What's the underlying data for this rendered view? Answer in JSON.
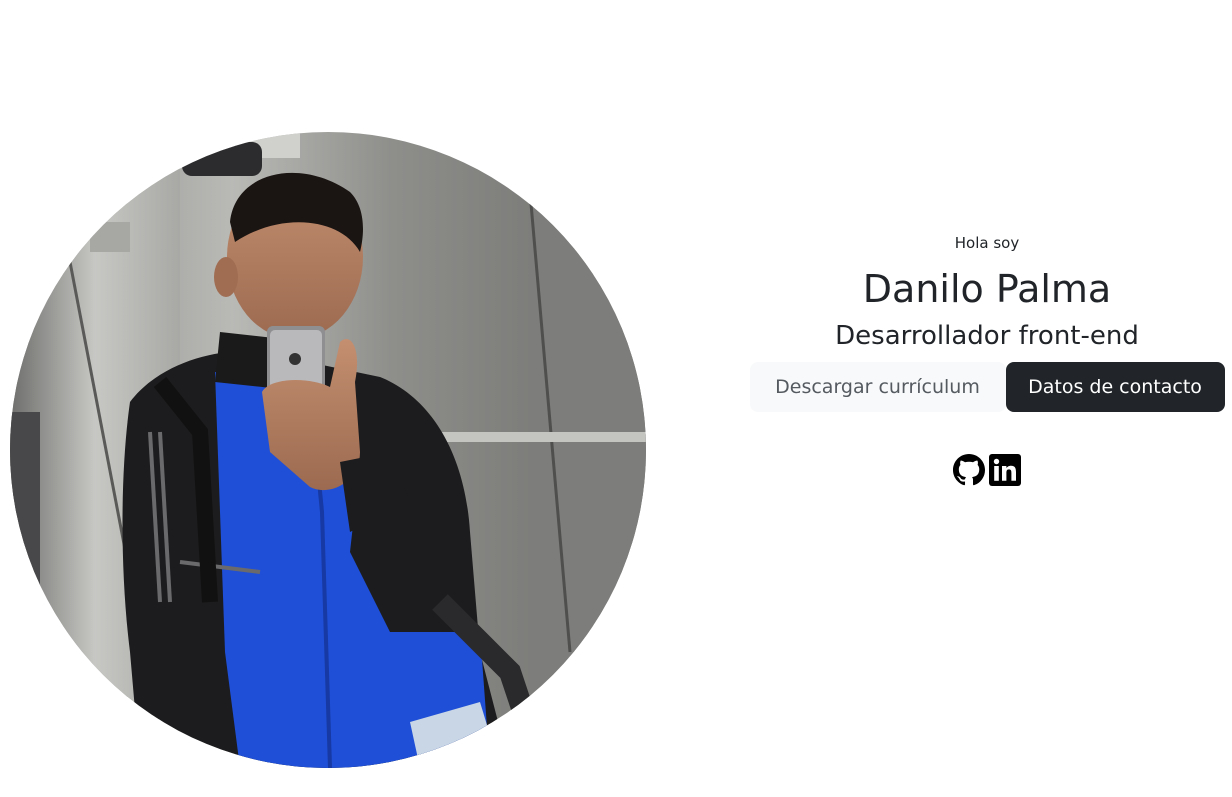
{
  "hero": {
    "greeting": "Hola soy",
    "name": "Danilo Palma",
    "role": "Desarrollador front-end",
    "buttons": {
      "resume": "Descargar currículum",
      "contact": "Datos de contacto"
    },
    "social_links": [
      {
        "icon": "github-icon"
      },
      {
        "icon": "linkedin-icon"
      }
    ]
  },
  "colors": {
    "dark": "#212529",
    "light": "#f8f9fa",
    "jacket_blue": "#1f4fd6",
    "jacket_black": "#1c1c1e",
    "elevator_steel": "#9a9a98"
  }
}
